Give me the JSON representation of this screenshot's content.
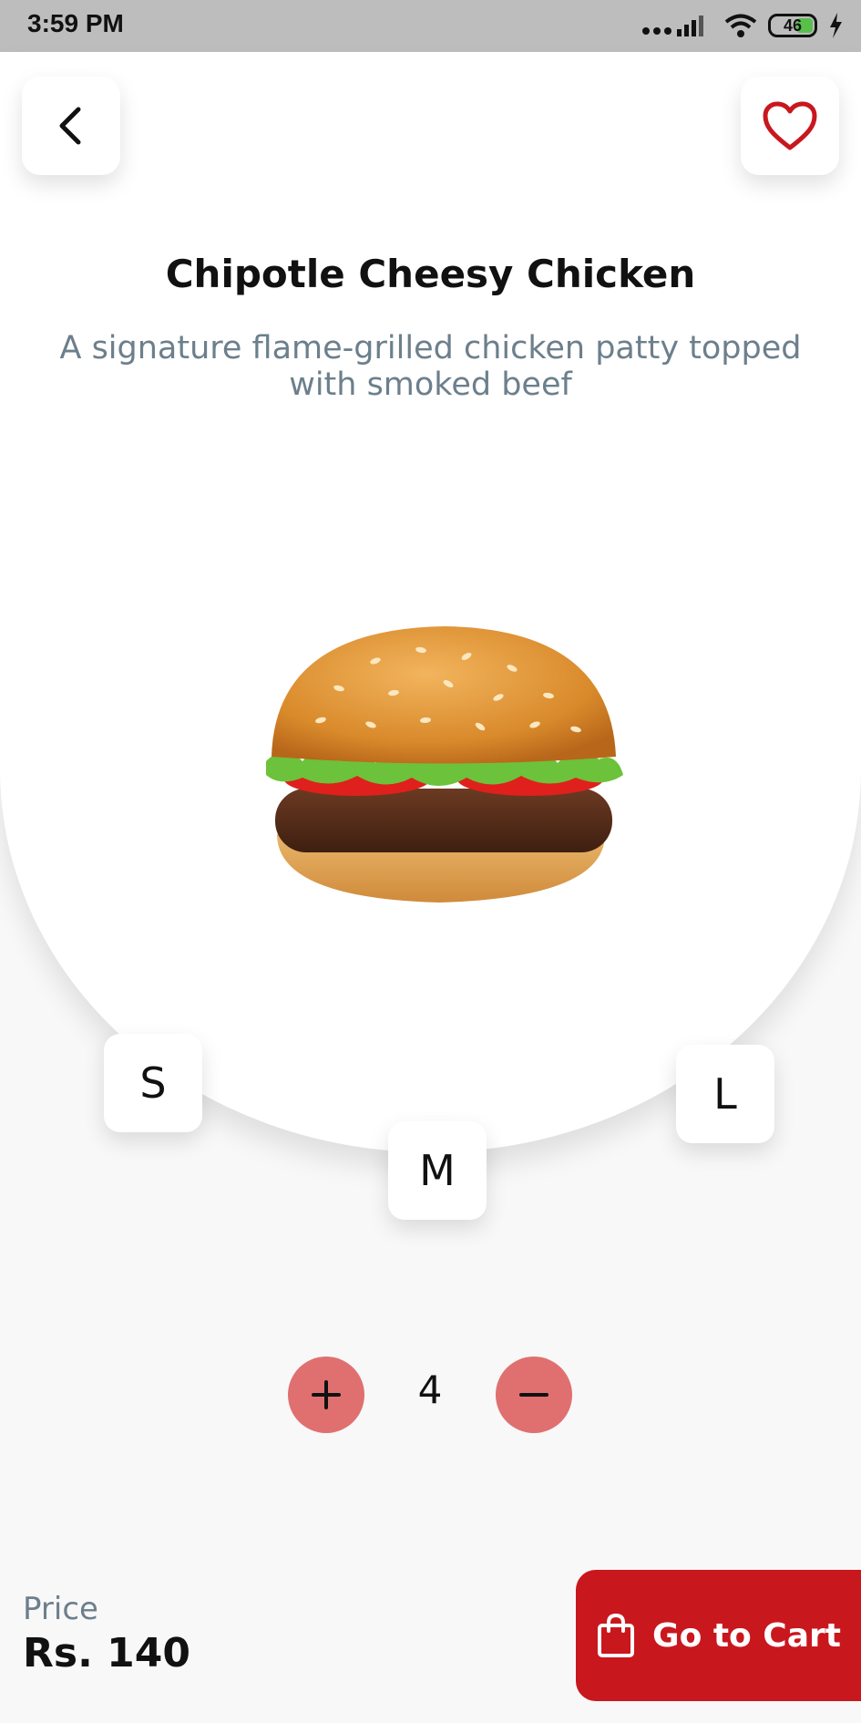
{
  "status_bar": {
    "time": "3:59 PM",
    "battery": "46"
  },
  "product": {
    "name": "Chipotle Cheesy Chicken",
    "description": "A signature flame-grilled chicken patty topped with smoked beef"
  },
  "sizes": {
    "small": "S",
    "medium": "M",
    "large": "L"
  },
  "quantity": {
    "value": "4"
  },
  "price": {
    "label": "Price",
    "value": "Rs. 140"
  },
  "cart": {
    "label": "Go to Cart"
  },
  "icons": {
    "back": "chevron-left-icon",
    "favorite": "heart-icon",
    "plus": "plus-icon",
    "minus": "minus-icon",
    "bag": "shopping-bag-icon"
  },
  "colors": {
    "accent": "#c9171e",
    "qty_button": "#e07070",
    "heart": "#c9171e",
    "muted_text": "#6c7f8c"
  }
}
